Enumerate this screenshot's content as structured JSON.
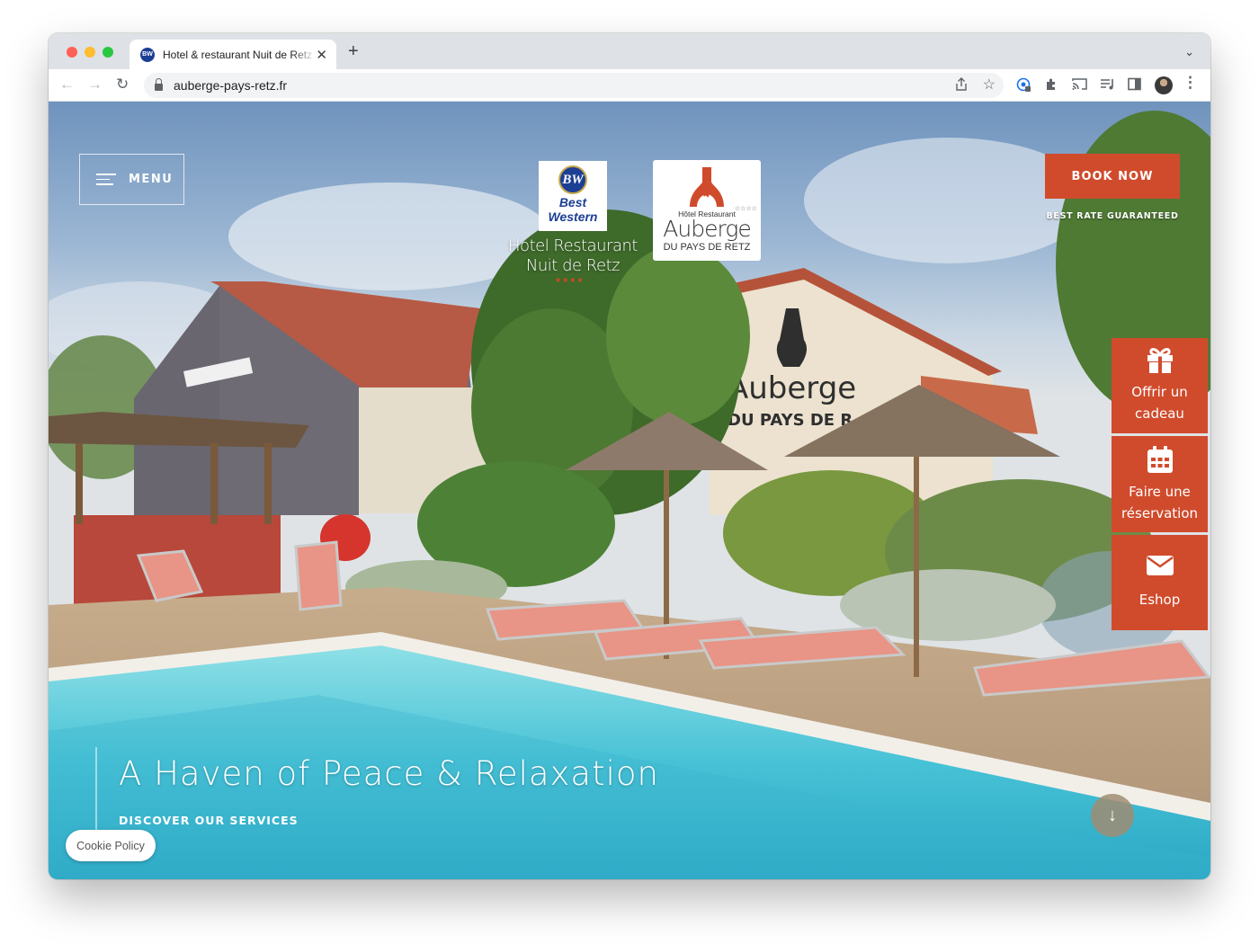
{
  "browser": {
    "tab_title": "Hotel & restaurant Nuit de Retz",
    "favicon_text": "BW",
    "new_tab": "+",
    "tab_close": "✕",
    "url": "auberge-pays-retz.fr"
  },
  "site": {
    "menu_label": "MENU",
    "logo_bw": {
      "badge": "BW",
      "line1": "Best",
      "line2": "Western",
      "subtitle_line1": "Hotel Restaurant",
      "subtitle_line2": "Nuit de Retz",
      "stars": "★★★★"
    },
    "logo_auberge": {
      "small": "Hôtel Restaurant",
      "stars": "☆☆☆☆",
      "name": "Auberge",
      "sub": "DU PAYS DE RETZ"
    },
    "book_now": "BOOK NOW",
    "best_rate": "BEST RATE GUARANTEED",
    "side_actions": [
      {
        "label": "Offrir un cadeau",
        "icon": "gift-icon"
      },
      {
        "label": "Faire une réservation",
        "icon": "calendar-icon"
      },
      {
        "label": "Eshop",
        "icon": "envelope-icon"
      }
    ],
    "hero_title": "A Haven of Peace & Relaxation",
    "hero_link": "DISCOVER OUR SERVICES",
    "scroll_arrow": "↓",
    "cookie_policy": "Cookie Policy"
  },
  "colors": {
    "accent": "#d04b2c",
    "bw_blue": "#1c3f94"
  }
}
